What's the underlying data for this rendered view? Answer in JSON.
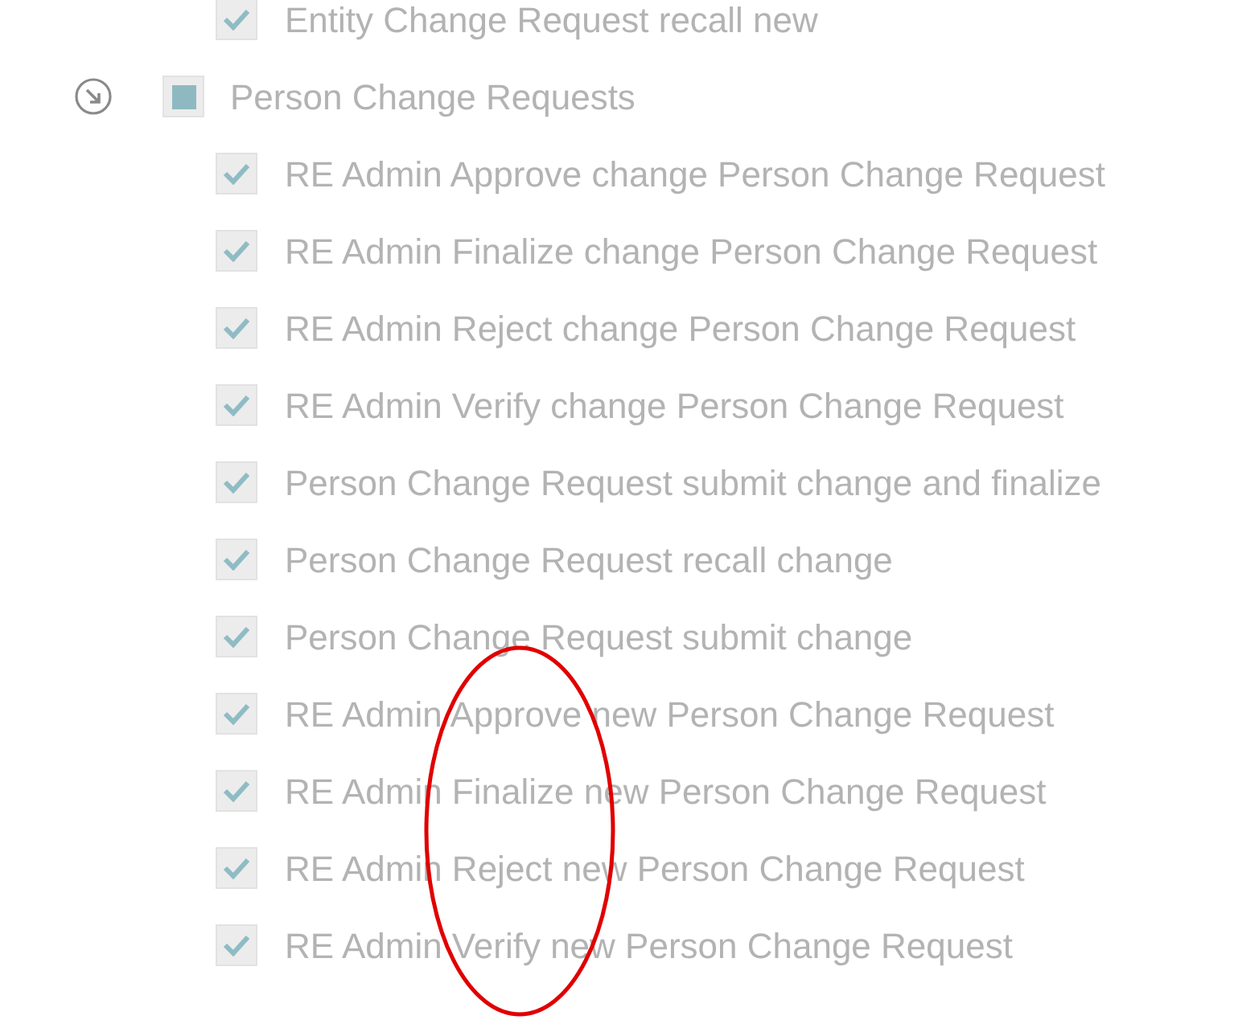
{
  "items": [
    {
      "kind": "child",
      "label": "Entity Change Request recall new",
      "checked": true
    },
    {
      "kind": "group",
      "label": "Person Change Requests",
      "expanded": true,
      "indeterminate": true,
      "children": [
        {
          "label": "RE Admin Approve change Person Change Request",
          "checked": true
        },
        {
          "label": "RE Admin Finalize change Person Change Request",
          "checked": true
        },
        {
          "label": "RE Admin Reject change Person Change Request",
          "checked": true
        },
        {
          "label": "RE Admin Verify change Person Change Request",
          "checked": true
        },
        {
          "label": "Person Change Request submit change and finalize",
          "checked": true
        },
        {
          "label": "Person Change Request recall change",
          "checked": true
        },
        {
          "label": "Person Change Request submit change",
          "checked": true
        },
        {
          "label": "RE Admin Approve new Person Change Request",
          "checked": true
        },
        {
          "label": "RE Admin Finalize new Person Change Request",
          "checked": true
        },
        {
          "label": "RE Admin Reject new Person Change Request",
          "checked": true
        },
        {
          "label": "RE Admin Verify new Person Change Request",
          "checked": true
        }
      ]
    }
  ],
  "annotation": {
    "kind": "ellipse",
    "color": "#e00000"
  }
}
